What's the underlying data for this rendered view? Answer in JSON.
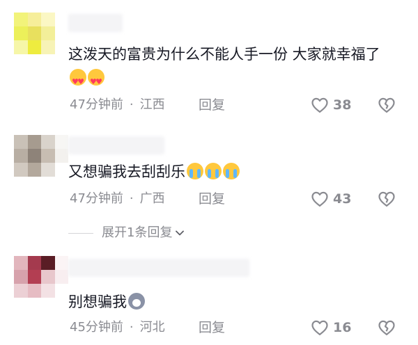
{
  "comments": [
    {
      "text": "这泼天的富贵为什么不能人手一份 大家就幸福了",
      "emoji": [
        "heart-eyes-emoji",
        "heart-eyes-emoji"
      ],
      "time": "47分钟前",
      "location": "江西",
      "reply_label": "回复",
      "likes": "38"
    },
    {
      "text": "又想骗我去刮刮乐",
      "emoji": [
        "crying-emoji",
        "crying-emoji",
        "crying-emoji"
      ],
      "time": "47分钟前",
      "location": "广西",
      "reply_label": "回复",
      "likes": "43",
      "expand_label": "展开1条回复"
    },
    {
      "text": "别想骗我",
      "emoji": [
        "husky-emoji"
      ],
      "time": "45分钟前",
      "location": "河北",
      "reply_label": "回复",
      "likes": "16"
    }
  ],
  "separator": "·",
  "colors": {
    "text": "#161823",
    "meta": "#8a8b91",
    "heart_face": "#ffc83d",
    "tear": "#5fb7ff"
  }
}
